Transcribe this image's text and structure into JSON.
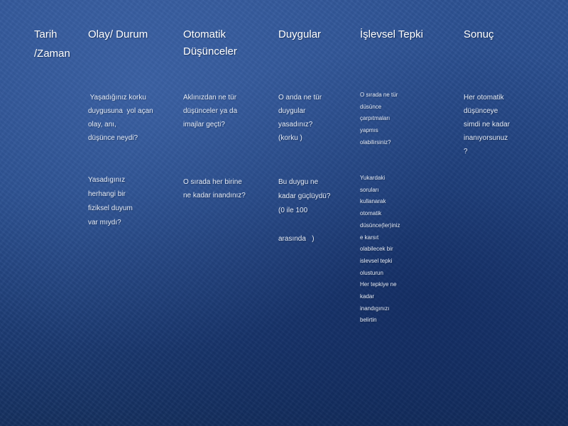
{
  "table": {
    "headers": {
      "tarih": [
        "Tarih",
        "/Zaman"
      ],
      "olay": [
        "Olay/ Durum"
      ],
      "otomatik": [
        "Otomatik",
        "Düşünceler"
      ],
      "duygular": [
        "Duygular"
      ],
      "islevsel": [
        "İşlevsel Tepki"
      ],
      "sonuc": [
        "Sonuç"
      ]
    },
    "row1": {
      "olay": [
        " Yaşadığınız korku",
        "duygusuna  yol açan",
        "olay, anı,",
        "düşünce neydi?"
      ],
      "otomatik": [
        "Aklınızdan ne tür",
        "düşünceler ya da",
        "imajlar geçti?"
      ],
      "duygular": [
        "O anda ne tür",
        "duygular",
        "yasadınız?",
        "(korku )"
      ],
      "islevsel": [
        "O sırada ne tür",
        "düsünce",
        "çarpıtmaları",
        "yapmıs",
        "olabilirsiniz?"
      ],
      "sonuc": [
        "Her otomatik",
        "düşünceye",
        "simdi ne kadar",
        "inanıyorsunuz",
        "?"
      ]
    },
    "row2": {
      "olay": [
        "Yasadıgınız",
        "herhangi bir",
        "fiziksel duyum",
        "var mıydı?"
      ],
      "otomatik": [
        "O sırada her birine",
        "ne kadar inandınız?"
      ],
      "duygular": [
        "Bu duygu ne",
        "kadar güçlüydü?",
        "(0 ile 100",
        "",
        "arasında   )"
      ],
      "islevsel": [
        "Yukardaki",
        "soruları",
        "kullanarak",
        "otomatik",
        "düsünce(ler)iniz",
        "e karsıt",
        "olabilecek bir",
        "islevsel tepki",
        "olusturun",
        "Her tepkiye ne",
        "kadar",
        "inandıgınızı",
        "belirtin"
      ]
    }
  }
}
